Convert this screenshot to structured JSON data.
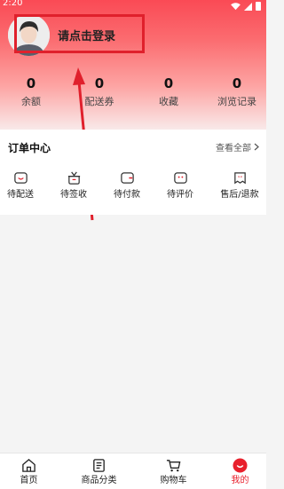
{
  "statusbar": {
    "time": "2:20"
  },
  "profile": {
    "login_text": "请点击登录"
  },
  "stats": [
    {
      "value": "0",
      "label": "余额"
    },
    {
      "value": "0",
      "label": "配送券"
    },
    {
      "value": "0",
      "label": "收藏"
    },
    {
      "value": "0",
      "label": "浏览记录"
    }
  ],
  "orders": {
    "title": "订单中心",
    "view_all": "查看全部",
    "items": [
      {
        "label": "待配送",
        "icon": "pending-delivery-icon"
      },
      {
        "label": "待签收",
        "icon": "pending-receipt-icon"
      },
      {
        "label": "待付款",
        "icon": "pending-payment-icon"
      },
      {
        "label": "待评价",
        "icon": "pending-review-icon"
      },
      {
        "label": "售后/退款",
        "icon": "after-sales-icon"
      }
    ]
  },
  "tabbar": {
    "items": [
      {
        "label": "首页",
        "icon": "home-icon"
      },
      {
        "label": "商品分类",
        "icon": "category-icon"
      },
      {
        "label": "购物车",
        "icon": "cart-icon"
      },
      {
        "label": "我的",
        "icon": "profile-icon"
      }
    ],
    "active": "我的"
  },
  "colors": {
    "accent": "#e8202c",
    "highlight_box": "#e0202c"
  }
}
